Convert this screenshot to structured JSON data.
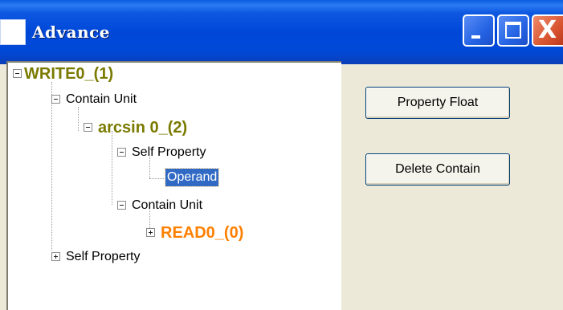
{
  "window": {
    "title": "Advance",
    "controls": {
      "minimize": "minimize-icon",
      "maximize": "maximize-icon",
      "close": "close-icon",
      "close_glyph": "X"
    }
  },
  "tree": {
    "root": {
      "label": "WRITE0_(1)",
      "expanded": true,
      "color": "#7A7A00"
    },
    "root_contain_unit": {
      "label": "Contain Unit",
      "expanded": true
    },
    "arcsin": {
      "label": "arcsin 0_(2)",
      "expanded": true,
      "color": "#7A7A00"
    },
    "arcsin_self_property": {
      "label": "Self Property",
      "expanded": true
    },
    "operand": {
      "label": "Operand",
      "selected": true
    },
    "arcsin_contain_unit": {
      "label": "Contain Unit",
      "expanded": true
    },
    "read": {
      "label": "READ0_(0)",
      "expanded": false,
      "color": "#FF8000"
    },
    "root_self_property": {
      "label": "Self Property",
      "expanded": false
    }
  },
  "buttons": {
    "property_float": "Property Float",
    "delete_contain": "Delete Contain"
  }
}
